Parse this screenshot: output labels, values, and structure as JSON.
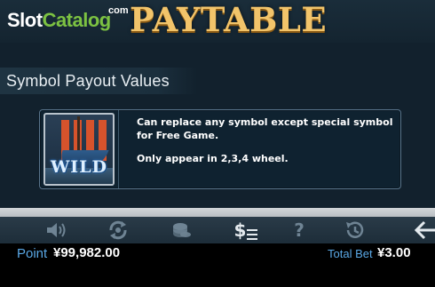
{
  "watermark": {
    "part1": "Slot",
    "part2": "Catalog",
    "suffix": "com"
  },
  "header": {
    "title": "PAYTABLE"
  },
  "section": {
    "title": "Symbol Payout Values"
  },
  "symbol_card": {
    "symbol_name": "WILD",
    "description_1": "Can replace any symbol except special symbol for Free Game.",
    "description_2": "Only appear in 2,3,4 wheel."
  },
  "toolbar": {
    "icons": [
      "sound-icon",
      "autoplay-icon",
      "coins-icon",
      "paytable-icon",
      "help-icon",
      "history-icon",
      "back-arrow-icon"
    ],
    "active": "paytable-icon",
    "paytable_glyph": "$",
    "help_glyph": "?"
  },
  "status": {
    "point_label": "Point",
    "point_value": "¥99,982.00",
    "bet_label": "Total Bet",
    "bet_value": "¥3.00"
  },
  "colors": {
    "title_gold": "#f2c46a",
    "label_blue": "#5aa8e6",
    "background": "#12212d",
    "toolbar": "#22333f"
  }
}
